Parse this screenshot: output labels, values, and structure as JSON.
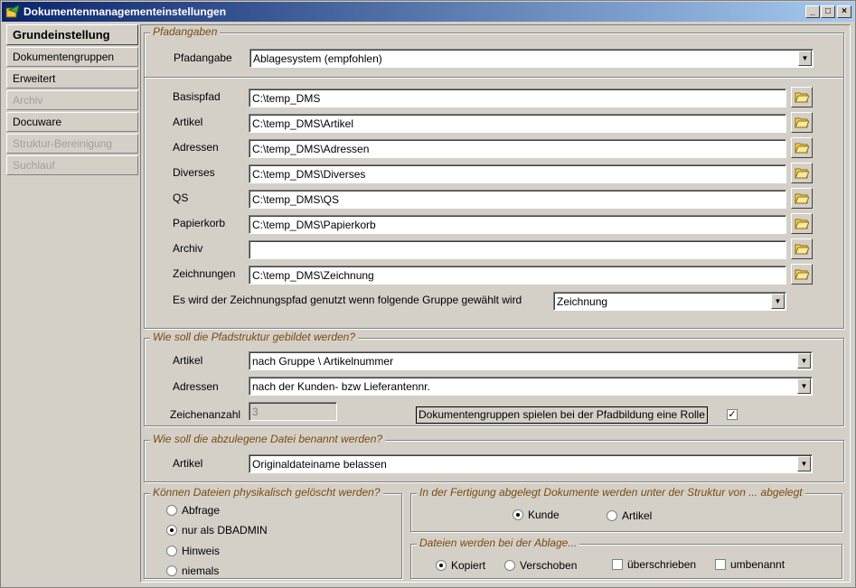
{
  "window": {
    "title": "Dokumentenmanagementeinstellungen",
    "btn_min": "_",
    "btn_max": "□",
    "btn_close": "×"
  },
  "nav": {
    "grundeinstellung": "Grundeinstellung",
    "dokumentengruppen": "Dokumentengruppen",
    "erweitert": "Erweitert",
    "archiv": "Archiv",
    "docuware": "Docuware",
    "struktur": "Struktur-Bereinigung",
    "suchlauf": "Suchlauf"
  },
  "pfadangaben": {
    "legend": "Pfadangaben",
    "pfadangabe_label": "Pfadangabe",
    "pfadangabe_value": "Ablagesystem (empfohlen)",
    "basispfad_label": "Basispfad",
    "basispfad_value": "C:\\temp_DMS",
    "artikel_label": "Artikel",
    "artikel_value": "C:\\temp_DMS\\Artikel",
    "adressen_label": "Adressen",
    "adressen_value": "C:\\temp_DMS\\Adressen",
    "diverses_label": "Diverses",
    "diverses_value": "C:\\temp_DMS\\Diverses",
    "qs_label": "QS",
    "qs_value": "C:\\temp_DMS\\QS",
    "papierkorb_label": "Papierkorb",
    "papierkorb_value": "C:\\temp_DMS\\Papierkorb",
    "archiv_label": "Archiv",
    "archiv_value": "",
    "zeichnungen_label": "Zeichnungen",
    "zeichnungen_value": "C:\\temp_DMS\\Zeichnung",
    "zeichnungspfad_label": "Es wird der Zeichnungspfad genutzt wenn folgende Gruppe gewählt wird",
    "zeichnungspfad_value": "Zeichnung"
  },
  "pfadstruktur": {
    "legend": "Wie soll die Pfadstruktur gebildet werden?",
    "artikel_label": "Artikel",
    "artikel_value": "nach Gruppe \\ Artikelnummer",
    "adressen_label": "Adressen",
    "adressen_value": "nach der Kunden- bzw Lieferantennr.",
    "zeichenanzahl_label": "Zeichenanzahl",
    "zeichenanzahl_value": "3",
    "dokgruppen_label": "Dokumentengruppen spielen bei der Pfadbildung eine Rolle",
    "dokgruppen_check": "✓"
  },
  "dateiname": {
    "legend": "Wie soll die abzulegene Datei benannt werden?",
    "artikel_label": "Artikel",
    "artikel_value": "Originaldateiname belassen"
  },
  "loeschen": {
    "legend": "Können Dateien physikalisch gelöscht werden?",
    "abfrage": "Abfrage",
    "dbadmin": "nur als DBADMIN",
    "hinweis": "Hinweis",
    "niemals": "niemals"
  },
  "fertigung": {
    "legend": "In der Fertigung abgelegt Dokumente werden unter der Struktur von ... abgelegt",
    "kunde": "Kunde",
    "artikel": "Artikel"
  },
  "ablage": {
    "legend": "Dateien werden bei der Ablage...",
    "kopiert": "Kopiert",
    "verschoben": "Verschoben",
    "ueberschrieben": "überschrieben",
    "umbenannt": "umbenannt"
  }
}
